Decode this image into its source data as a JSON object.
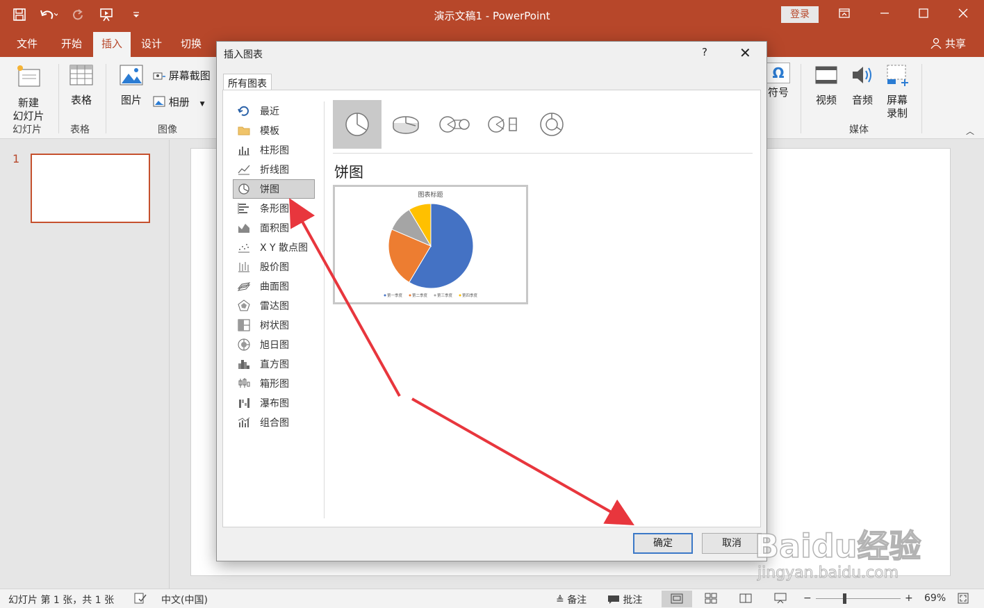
{
  "window": {
    "title": "演示文稿1  -  PowerPoint",
    "login": "登录"
  },
  "colors": {
    "accent": "#b7472a",
    "pie": [
      "#4472c4",
      "#ed7d31",
      "#a5a5a5",
      "#ffc000"
    ]
  },
  "tabs": [
    "文件",
    "开始",
    "插入",
    "设计",
    "切换"
  ],
  "share": "共享",
  "ribbon": {
    "new_slide": "新建\n幻灯片",
    "table": "表格",
    "picture": "图片",
    "screenshot": "屏幕截图",
    "album": "相册",
    "symbol": "符号",
    "video": "视频",
    "audio": "音频",
    "screen_record": "屏幕\n录制",
    "groups": {
      "slides": "幻灯片",
      "tables": "表格",
      "images": "图像",
      "media": "媒体"
    }
  },
  "slides_pane": {
    "slide_number": "1"
  },
  "dialog": {
    "title": "插入图表",
    "help": "?",
    "tab": "所有图表",
    "categories": [
      {
        "label": "最近",
        "icon": "recent-icon"
      },
      {
        "label": "模板",
        "icon": "folder-icon"
      },
      {
        "label": "柱形图",
        "icon": "column-chart-icon"
      },
      {
        "label": "折线图",
        "icon": "line-chart-icon"
      },
      {
        "label": "饼图",
        "icon": "pie-chart-icon",
        "selected": true
      },
      {
        "label": "条形图",
        "icon": "bar-chart-icon"
      },
      {
        "label": "面积图",
        "icon": "area-chart-icon"
      },
      {
        "label": "X Y 散点图",
        "icon": "scatter-chart-icon"
      },
      {
        "label": "股价图",
        "icon": "stock-chart-icon"
      },
      {
        "label": "曲面图",
        "icon": "surface-chart-icon"
      },
      {
        "label": "雷达图",
        "icon": "radar-chart-icon"
      },
      {
        "label": "树状图",
        "icon": "treemap-chart-icon"
      },
      {
        "label": "旭日图",
        "icon": "sunburst-chart-icon"
      },
      {
        "label": "直方图",
        "icon": "histogram-chart-icon"
      },
      {
        "label": "箱形图",
        "icon": "box-chart-icon"
      },
      {
        "label": "瀑布图",
        "icon": "waterfall-chart-icon"
      },
      {
        "label": "组合图",
        "icon": "combo-chart-icon"
      }
    ],
    "subtype_title": "饼图",
    "preview": {
      "title": "图表标题",
      "legend": [
        "第一季度",
        "第二季度",
        "第三季度",
        "第四季度"
      ]
    },
    "ok": "确定",
    "cancel": "取消"
  },
  "chart_data": {
    "type": "pie",
    "title": "图表标题",
    "categories": [
      "第一季度",
      "第二季度",
      "第三季度",
      "第四季度"
    ],
    "values": [
      8.2,
      3.2,
      1.4,
      1.2
    ]
  },
  "status": {
    "slide_info": "幻灯片 第 1 张，共 1 张",
    "language": "中文(中国)",
    "notes": "备注",
    "comments": "批注",
    "zoom": "69%"
  },
  "watermark": {
    "brand": "Baidu经验",
    "url": "jingyan.baidu.com"
  }
}
